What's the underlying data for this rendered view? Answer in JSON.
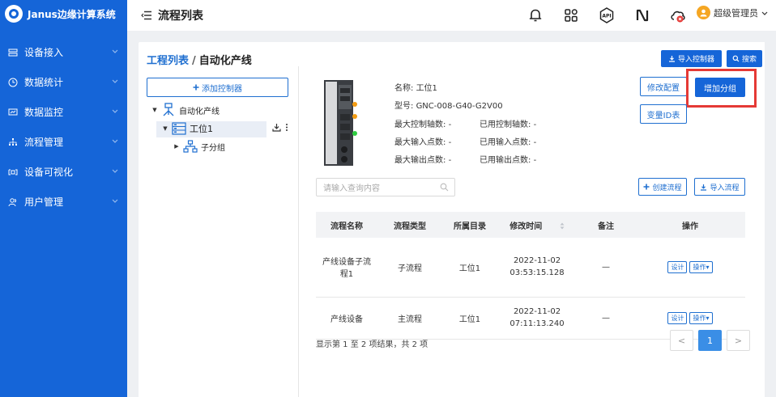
{
  "app": {
    "name": "Janus边缘计算系统"
  },
  "sidebar": {
    "items": [
      {
        "label": "设备接入",
        "icon": "device-access-icon"
      },
      {
        "label": "数据统计",
        "icon": "clock-icon"
      },
      {
        "label": "数据监控",
        "icon": "monitor-icon"
      },
      {
        "label": "流程管理",
        "icon": "flow-icon"
      },
      {
        "label": "设备可视化",
        "icon": "visual-icon"
      },
      {
        "label": "用户管理",
        "icon": "users-icon"
      }
    ]
  },
  "header": {
    "title": "流程列表",
    "icons": [
      "bell-icon",
      "apps-icon",
      "api-icon",
      "nfc-icon",
      "cloud-error-icon"
    ],
    "api_text": "API",
    "user": "超级管理员"
  },
  "breadcrumb": {
    "parent": "工程列表",
    "separator": "/",
    "current": "自动化产线"
  },
  "toolbar": {
    "import_controller": "导入控制器",
    "search": "搜索"
  },
  "tree": {
    "add_controller": "添加控制器",
    "root": "自动化产线",
    "child": "工位1",
    "grandchild": "子分组"
  },
  "device": {
    "name_label": "名称:",
    "name": "工位1",
    "model_label": "型号:",
    "model": "GNC-008-G40-G2V00",
    "stats": [
      {
        "label": "最大控制轴数:",
        "value": "-"
      },
      {
        "label": "已用控制轴数:",
        "value": "-"
      },
      {
        "label": "最大输入点数:",
        "value": "-"
      },
      {
        "label": "已用输入点数:",
        "value": "-"
      },
      {
        "label": "最大输出点数:",
        "value": "-"
      },
      {
        "label": "已用输出点数:",
        "value": "-"
      }
    ]
  },
  "actions": {
    "modify_config": "修改配置",
    "add_group": "增加分组",
    "variable_id_table": "变量ID表"
  },
  "flow": {
    "search_placeholder": "请输入查询内容",
    "create_flow": "创建流程",
    "import_flow": "导入流程",
    "columns": [
      "流程名称",
      "流程类型",
      "所属目录",
      "修改时间",
      "备注",
      "操作"
    ],
    "rows": [
      {
        "name": "产线设备子流程1",
        "type": "子流程",
        "dir": "工位1",
        "date": "2022-11-02",
        "time": "03:53:15.128",
        "note": "—",
        "design": "设计",
        "ops": "操作"
      },
      {
        "name": "产线设备",
        "type": "主流程",
        "dir": "工位1",
        "date": "2022-11-02",
        "time": "07:11:13.240",
        "note": "—",
        "design": "设计",
        "ops": "操作"
      }
    ],
    "summary": "显示第 1 至 2 项结果，共 2 项"
  },
  "pagination": {
    "prev": "<",
    "current": "1",
    "next": ">"
  },
  "colors": {
    "primary": "#1565d8",
    "highlight": "#e53935",
    "sidebar": "#1565d8"
  }
}
